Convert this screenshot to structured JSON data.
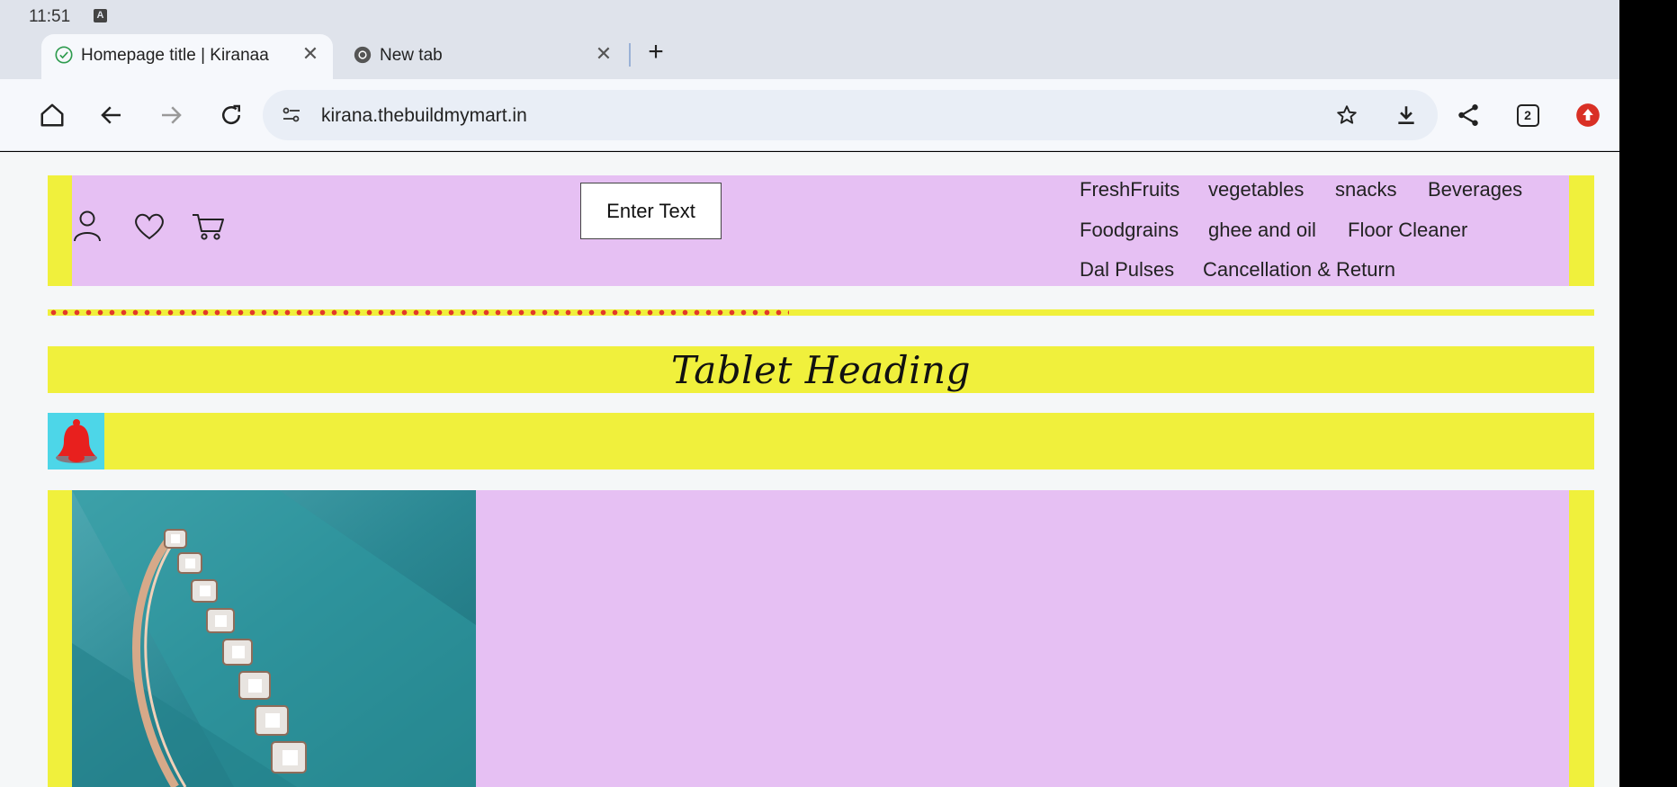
{
  "status_bar": {
    "time": "11:51",
    "indicator": "A"
  },
  "tabs": [
    {
      "title": "Homepage title | Kiranaa",
      "icon": "check-circle-icon",
      "active": true
    },
    {
      "title": "New tab",
      "icon": "chrome-icon",
      "active": false
    }
  ],
  "toolbar": {
    "url": "kirana.thebuildmymart.in",
    "tab_count": "2"
  },
  "site": {
    "search_button": "Enter Text",
    "nav": {
      "row1": [
        "FreshFruits",
        "vegetables",
        "snacks",
        "Beverages"
      ],
      "row2": [
        "Foodgrains",
        "ghee and oil",
        "Floor Cleaner"
      ],
      "row3": [
        "Dal Pulses",
        "Cancellation & Return"
      ]
    },
    "heading": "Tablet Heading"
  },
  "colors": {
    "yellow": "#f0f03c",
    "lilac": "#e6c0f3",
    "dots": "#e23a2a",
    "bell": "#e8201e",
    "bell_bg": "#4dd6e8"
  }
}
